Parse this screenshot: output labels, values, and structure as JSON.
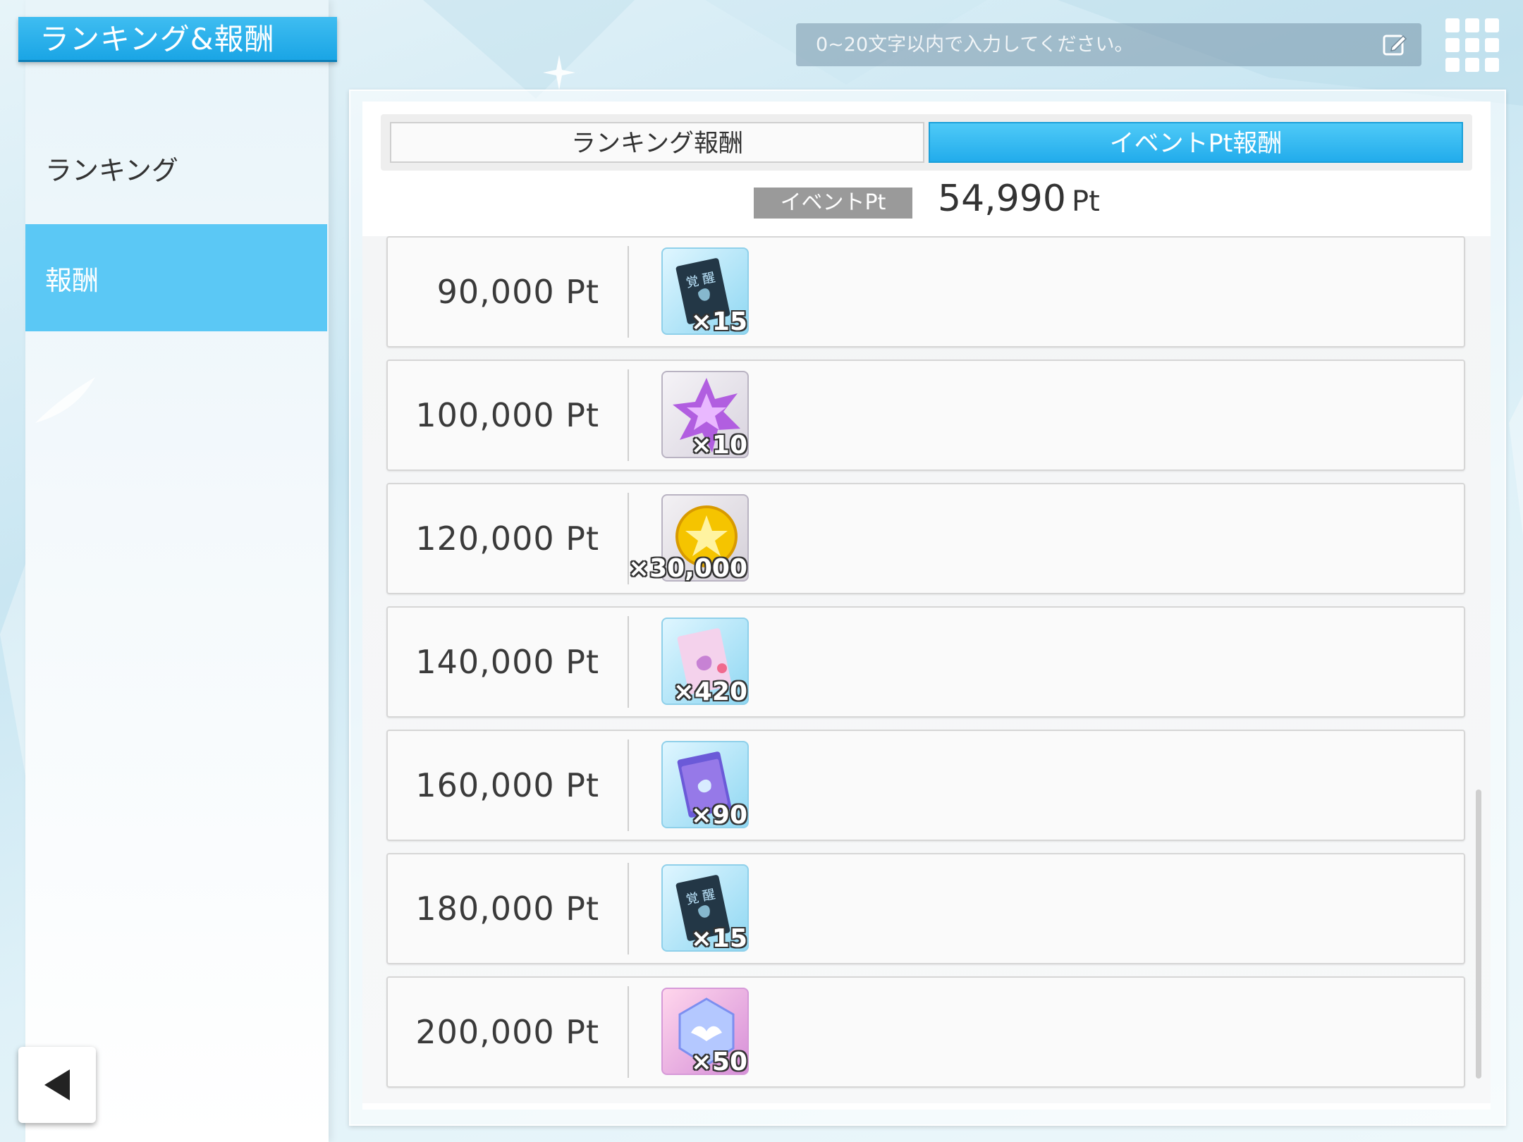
{
  "header": {
    "title": "ランキング&報酬",
    "search_placeholder": "0~20文字以内で入力してください。"
  },
  "sidebar": {
    "items": [
      {
        "label": "ランキング"
      },
      {
        "label": "報酬"
      }
    ]
  },
  "tabs": {
    "ranking_reward": "ランキング報酬",
    "event_pt_reward": "イベントPt報酬"
  },
  "event_points": {
    "badge": "イベントPt",
    "value": "54,990",
    "unit": "Pt"
  },
  "rewards": [
    {
      "points": "90,000 Pt",
      "icon": "awakening-book-icon",
      "quantity": "×15"
    },
    {
      "points": "100,000 Pt",
      "icon": "purple-star-crystal-icon",
      "quantity": "×10"
    },
    {
      "points": "120,000 Pt",
      "icon": "gold-star-coin-icon",
      "quantity": "×30,000"
    },
    {
      "points": "140,000 Pt",
      "icon": "pink-story-book-icon",
      "quantity": "×420"
    },
    {
      "points": "160,000 Pt",
      "icon": "kakusei-book-icon",
      "quantity": "×90"
    },
    {
      "points": "180,000 Pt",
      "icon": "awakening-book-icon",
      "quantity": "×15"
    },
    {
      "points": "200,000 Pt",
      "icon": "wing-gem-icon",
      "quantity": "×50"
    }
  ],
  "colors": {
    "accent": "#22acec",
    "sidebar_active": "#5bc8f5",
    "badge_gray": "#9a9a9a"
  }
}
